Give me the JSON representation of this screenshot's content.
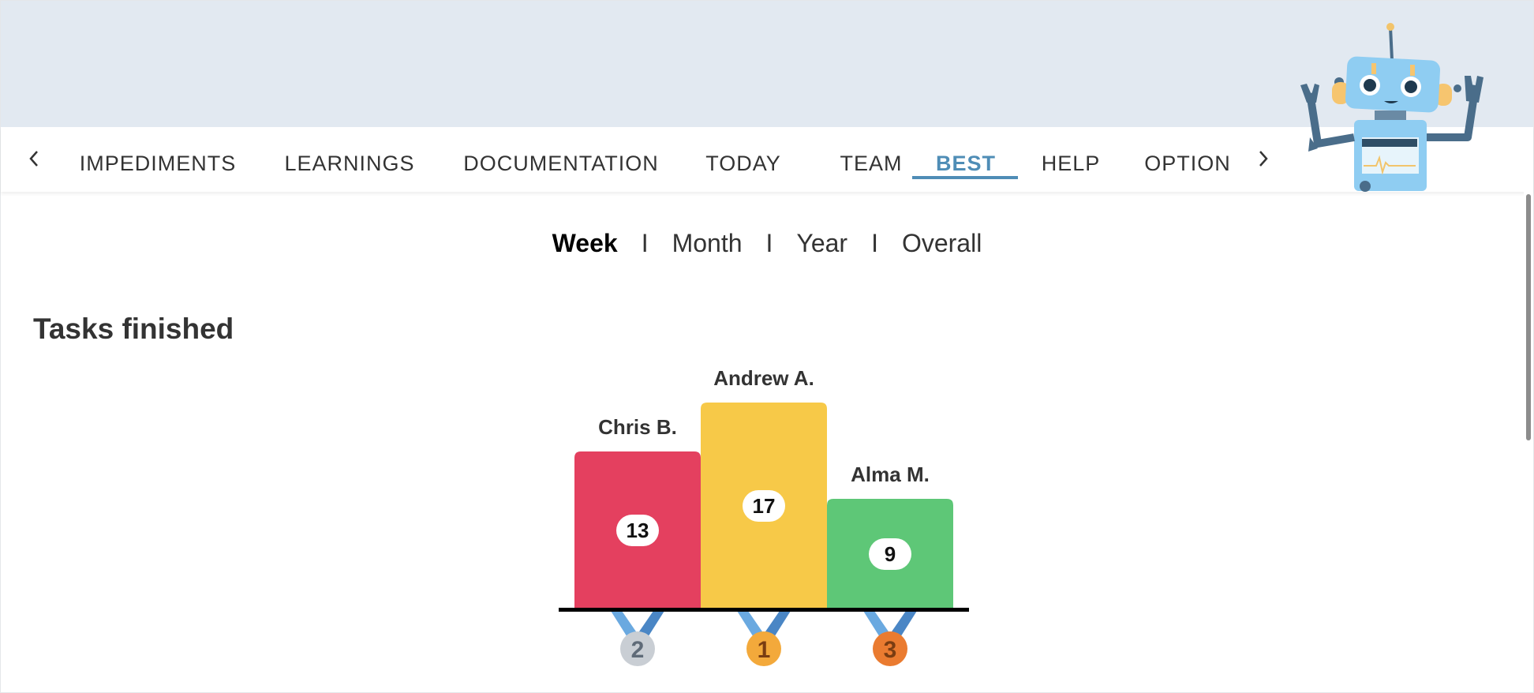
{
  "nav": {
    "tabs": [
      {
        "label": "IMPEDIMENTS",
        "active": false
      },
      {
        "label": "LEARNINGS",
        "active": false
      },
      {
        "label": "DOCUMENTATION",
        "active": false
      },
      {
        "label": "TODAY",
        "active": false
      },
      {
        "label": "TEAM",
        "active": false
      },
      {
        "label": "BEST",
        "active": true
      },
      {
        "label": "HELP",
        "active": false
      },
      {
        "label": "OPTION",
        "active": false
      }
    ],
    "accent_color": "#4f8db6"
  },
  "periods": {
    "items": [
      "Week",
      "Month",
      "Year",
      "Overall"
    ],
    "selected": "Week",
    "separator": "I"
  },
  "section": {
    "title": "Tasks finished"
  },
  "chart_data": {
    "type": "bar",
    "title": "Tasks finished",
    "categories": [
      "Chris B.",
      "Andrew A.",
      "Alma M."
    ],
    "values": [
      13,
      17,
      9
    ],
    "ranks": [
      2,
      1,
      3
    ],
    "colors": [
      "#e4405f",
      "#f7c948",
      "#5ec777"
    ],
    "medal_colors": [
      "#c9ced4",
      "#f3a93b",
      "#ea7b30"
    ],
    "xlabel": "",
    "ylabel": ""
  },
  "icons": {
    "left_arrow": "chevron-left-icon",
    "right_arrow": "chevron-right-icon",
    "mascot": "robot-mascot-icon"
  }
}
